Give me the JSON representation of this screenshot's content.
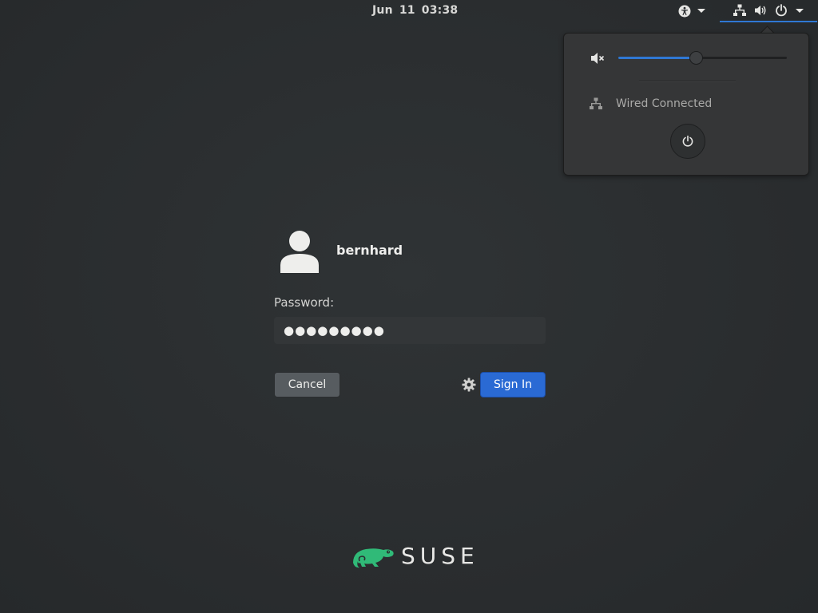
{
  "topbar": {
    "clock": "Jun 11  03:38",
    "icons": {
      "accessibility": "accessibility-icon",
      "network": "network-wired-icon",
      "volume": "volume-icon",
      "power": "power-icon"
    }
  },
  "system_menu": {
    "volume_level": 0.46,
    "volume_icon": "volume-muted-icon",
    "network_label": "Wired Connected",
    "power_icon": "power-icon"
  },
  "login": {
    "username": "bernhard",
    "password_label": "Password:",
    "password_value": "●●●●●●●●●",
    "cancel_label": "Cancel",
    "signin_label": "Sign In",
    "session_icon": "gear-icon"
  },
  "branding": {
    "logo_text": "SUSE",
    "logo_color": "#30ba78"
  },
  "colors": {
    "accent": "#2a6ad4",
    "background": "#2b2e30",
    "popover": "#353637"
  }
}
